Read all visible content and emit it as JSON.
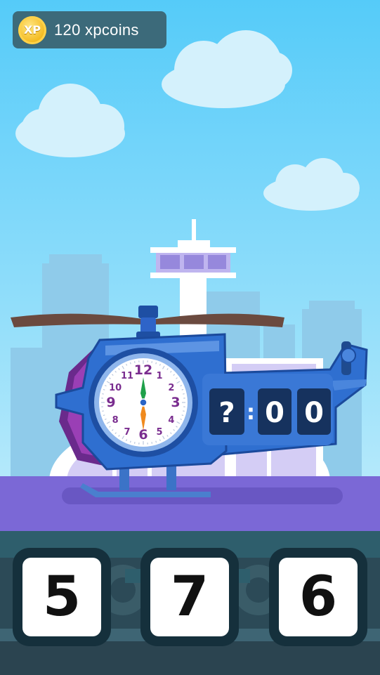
{
  "hud": {
    "xp_badge": "XP",
    "xp_amount": "120 xpcoins"
  },
  "clock": {
    "numbers": [
      "12",
      "1",
      "2",
      "3",
      "4",
      "5",
      "6",
      "7",
      "8",
      "9",
      "10",
      "11"
    ],
    "hour": 6,
    "minute": 0
  },
  "time_display": {
    "hour": "?",
    "separator": ":",
    "minutes_tens": "0",
    "minutes_ones": "0"
  },
  "answers": [
    {
      "label": "5"
    },
    {
      "label": "7"
    },
    {
      "label": "6"
    }
  ],
  "colors": {
    "sky": "#5bcdf8",
    "helicopter": "#2f6fd0",
    "floor": "#7b68d6"
  }
}
